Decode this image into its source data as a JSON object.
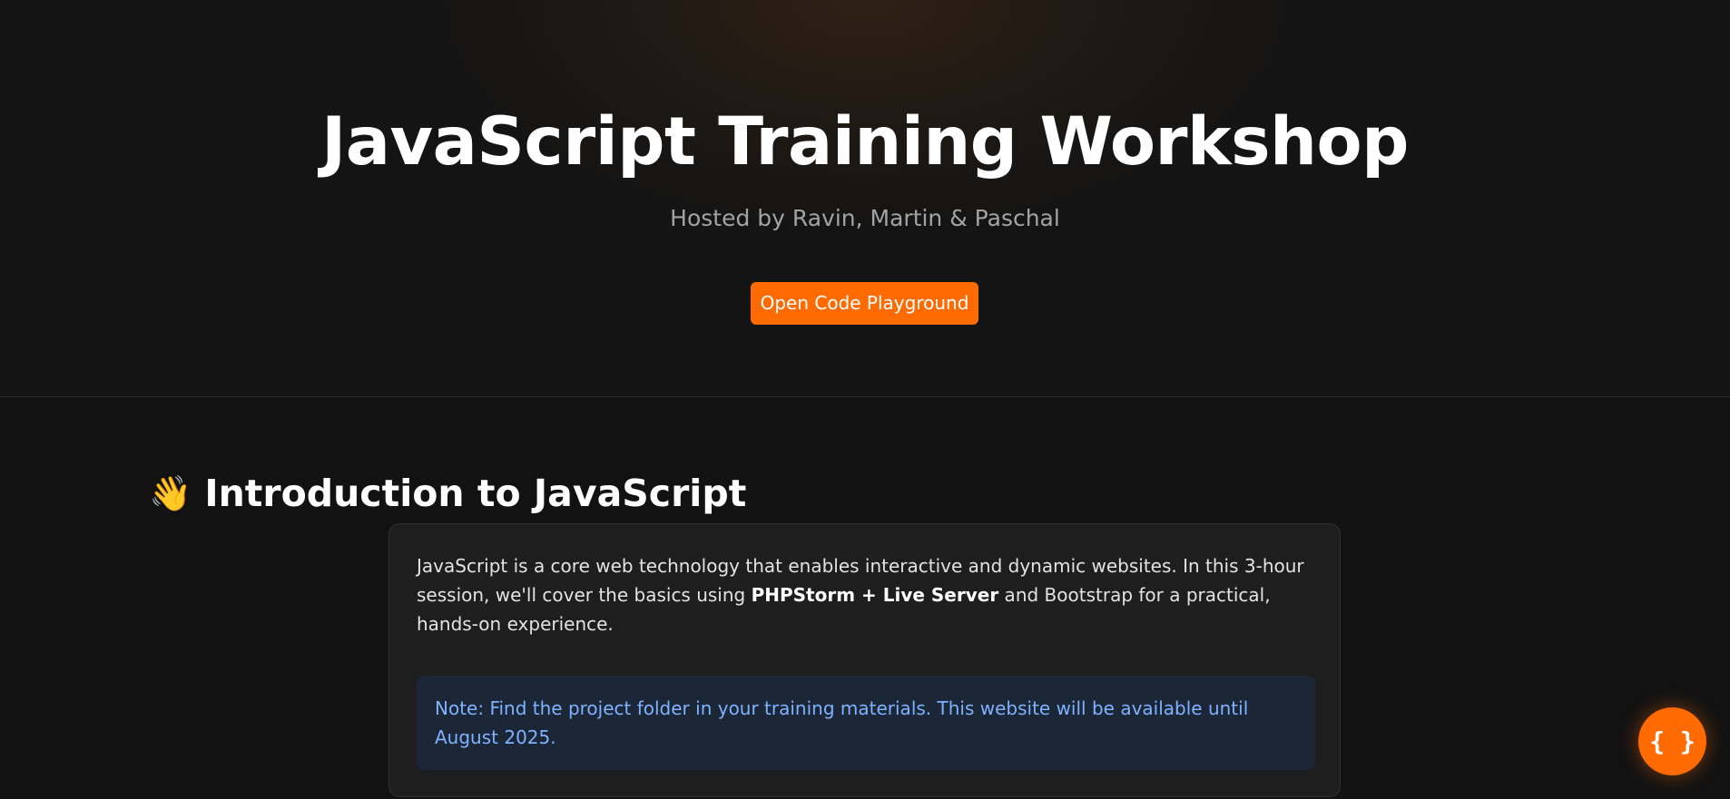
{
  "hero": {
    "title": "JavaScript Training Workshop",
    "subtitle": "Hosted by Ravin, Martin & Paschal",
    "cta_label": "Open Code Playground"
  },
  "intro": {
    "emoji": "👋",
    "heading": "Introduction to JavaScript",
    "paragraph_before": "JavaScript is a core web technology that enables interactive and dynamic websites. In this 3-hour session, we'll cover the basics using ",
    "paragraph_bold": "PHPStorm + Live Server",
    "paragraph_after": " and Bootstrap for a practical, hands-on experience.",
    "note": "Note: Find the project folder in your training materials. This website will be available until August 2025."
  },
  "fab": {
    "label": "{ }"
  },
  "colors": {
    "accent": "#ff6b00",
    "background": "#121212",
    "card": "#1e1e1e",
    "note_background": "#1b2637",
    "note_text": "#7fb2ff"
  }
}
